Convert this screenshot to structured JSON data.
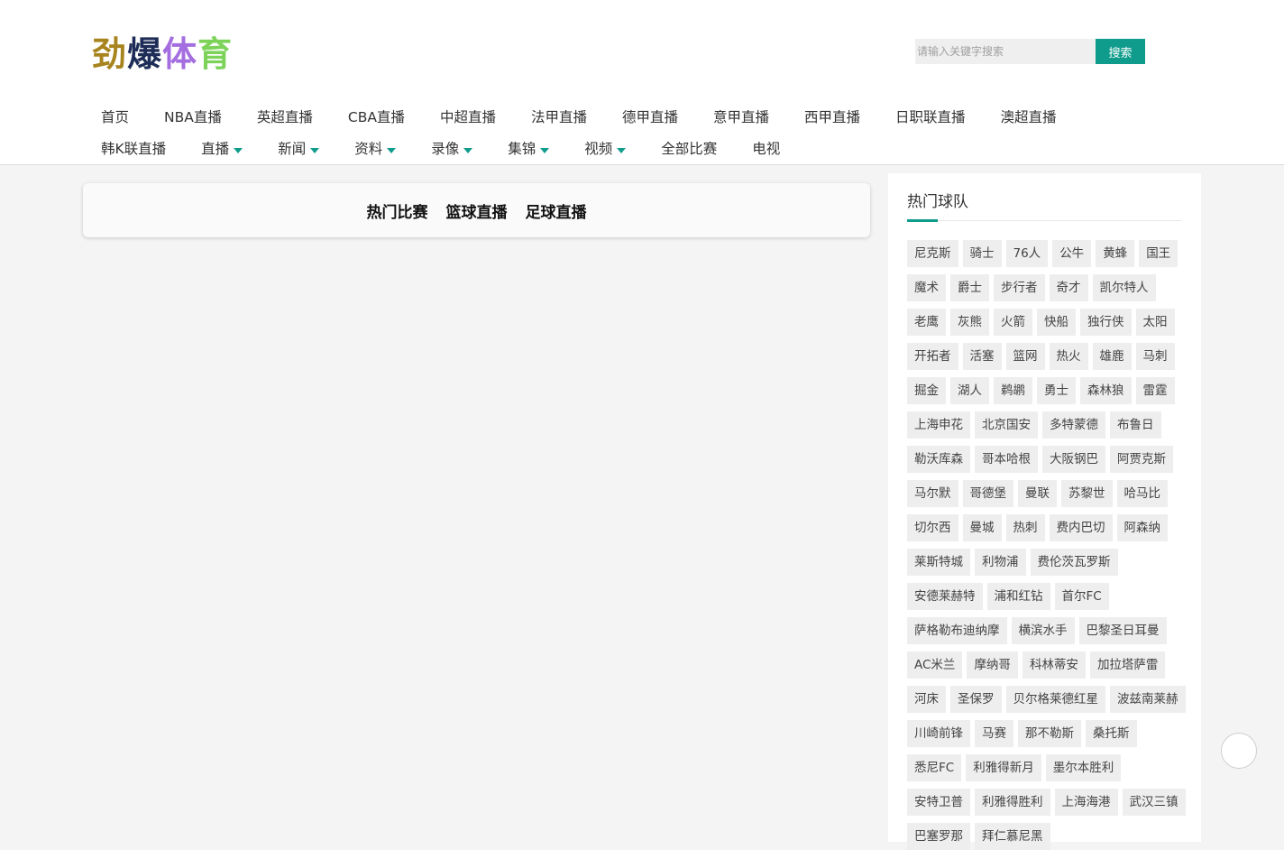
{
  "site": {
    "logo_chars": [
      {
        "text": "劲",
        "color": "#a8841f"
      },
      {
        "text": "爆",
        "color": "#1e2d57"
      },
      {
        "text": "体",
        "color": "#a46ee0"
      },
      {
        "text": "育",
        "color": "#7dd35a"
      }
    ]
  },
  "search": {
    "placeholder": "请输入关键字搜索",
    "button_label": "搜索"
  },
  "accent_color": "#0f9c8c",
  "nav": {
    "row1": [
      {
        "label": "首页",
        "dropdown": false
      },
      {
        "label": "NBA直播",
        "dropdown": false
      },
      {
        "label": "英超直播",
        "dropdown": false
      },
      {
        "label": "CBA直播",
        "dropdown": false
      },
      {
        "label": "中超直播",
        "dropdown": false
      },
      {
        "label": "法甲直播",
        "dropdown": false
      },
      {
        "label": "德甲直播",
        "dropdown": false
      },
      {
        "label": "意甲直播",
        "dropdown": false
      },
      {
        "label": "西甲直播",
        "dropdown": false
      },
      {
        "label": "日职联直播",
        "dropdown": false
      },
      {
        "label": "澳超直播",
        "dropdown": false
      }
    ],
    "row2": [
      {
        "label": "韩K联直播",
        "dropdown": false
      },
      {
        "label": "直播",
        "dropdown": true
      },
      {
        "label": "新闻",
        "dropdown": true
      },
      {
        "label": "资料",
        "dropdown": true
      },
      {
        "label": "录像",
        "dropdown": true
      },
      {
        "label": "集锦",
        "dropdown": true
      },
      {
        "label": "视频",
        "dropdown": true
      },
      {
        "label": "全部比赛",
        "dropdown": false
      },
      {
        "label": "电视",
        "dropdown": false
      }
    ]
  },
  "main": {
    "tabs": [
      "热门比赛",
      "篮球直播",
      "足球直播"
    ]
  },
  "sidebar": {
    "title": "热门球队",
    "teams": [
      "尼克斯",
      "骑士",
      "76人",
      "公牛",
      "黄蜂",
      "国王",
      "魔术",
      "爵士",
      "步行者",
      "奇才",
      "凯尔特人",
      "老鹰",
      "灰熊",
      "火箭",
      "快船",
      "独行侠",
      "太阳",
      "开拓者",
      "活塞",
      "篮网",
      "热火",
      "雄鹿",
      "马刺",
      "掘金",
      "湖人",
      "鹈鹕",
      "勇士",
      "森林狼",
      "雷霆",
      "上海申花",
      "北京国安",
      "多特蒙德",
      "布鲁日",
      "勒沃库森",
      "哥本哈根",
      "大阪钢巴",
      "阿贾克斯",
      "马尔默",
      "哥德堡",
      "曼联",
      "苏黎世",
      "哈马比",
      "切尔西",
      "曼城",
      "热刺",
      "费内巴切",
      "阿森纳",
      "莱斯特城",
      "利物浦",
      "费伦茨瓦罗斯",
      "安德莱赫特",
      "浦和红钻",
      "首尔FC",
      "萨格勒布迪纳摩",
      "横滨水手",
      "巴黎圣日耳曼",
      "AC米兰",
      "摩纳哥",
      "科林蒂安",
      "加拉塔萨雷",
      "河床",
      "圣保罗",
      "贝尔格莱德红星",
      "波兹南莱赫",
      "川崎前锋",
      "马赛",
      "那不勒斯",
      "桑托斯",
      "悉尼FC",
      "利雅得新月",
      "墨尔本胜利",
      "安特卫普",
      "利雅得胜利",
      "上海海港",
      "武汉三镇",
      "巴塞罗那",
      "拜仁慕尼黑"
    ]
  }
}
